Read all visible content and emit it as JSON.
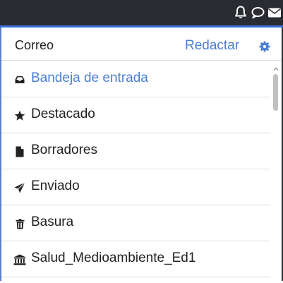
{
  "topbar": {
    "icons": [
      "bell-icon",
      "chat-bubble-icon",
      "envelope-icon"
    ]
  },
  "header": {
    "title": "Correo",
    "compose_label": "Redactar",
    "settings_icon": "gear-icon"
  },
  "folders": [
    {
      "label": "Bandeja de entrada",
      "icon": "inbox-icon",
      "active": true
    },
    {
      "label": "Destacado",
      "icon": "star-icon",
      "active": false
    },
    {
      "label": "Borradores",
      "icon": "document-icon",
      "active": false
    },
    {
      "label": "Enviado",
      "icon": "paper-plane-icon",
      "active": false
    },
    {
      "label": "Basura",
      "icon": "trash-icon",
      "active": false
    },
    {
      "label": "Salud_Medioambiente_Ed1",
      "icon": "institution-icon",
      "active": false
    }
  ],
  "colors": {
    "accent": "#4a7fd4",
    "topbar": "#2a2c31",
    "text": "#222222",
    "divider": "#dcdcdc"
  }
}
